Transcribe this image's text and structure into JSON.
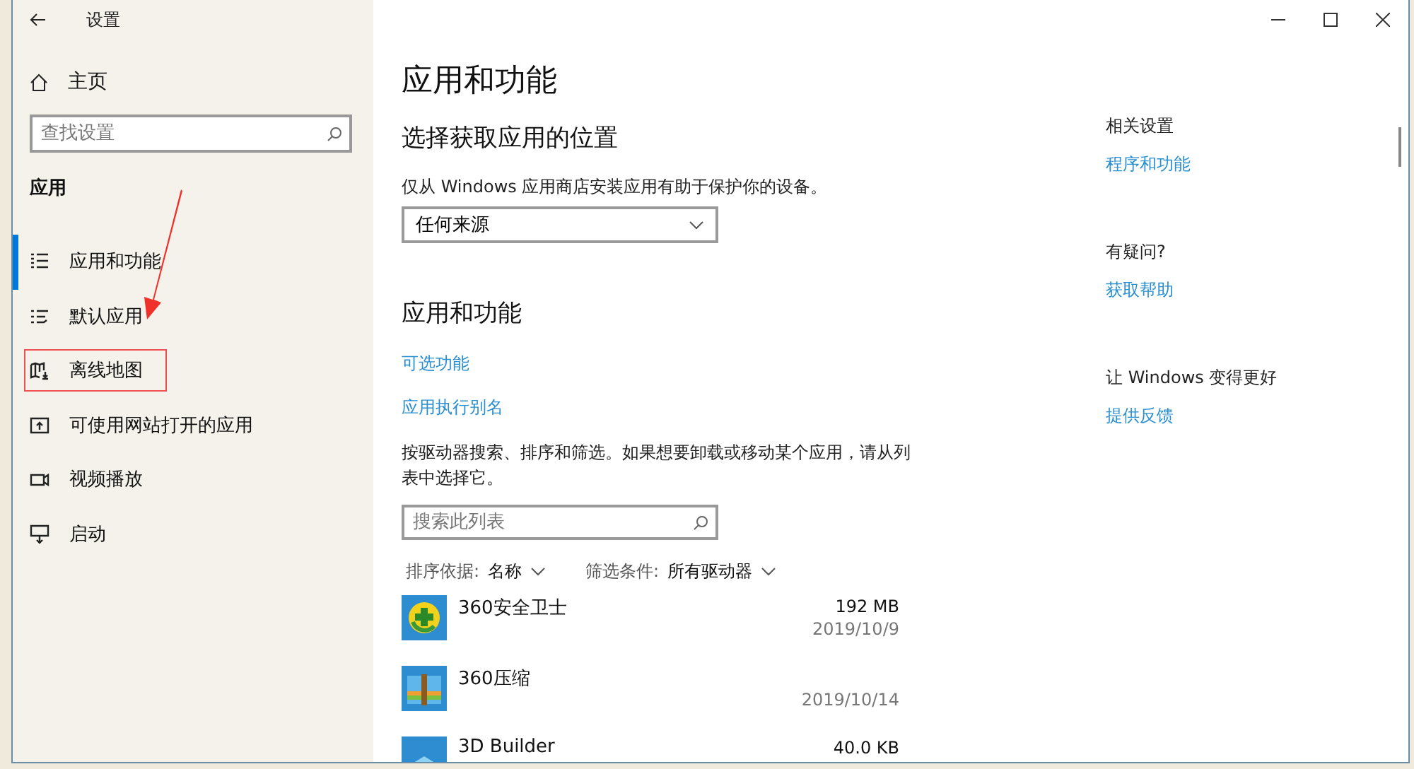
{
  "window": {
    "title": "设置"
  },
  "sidebar": {
    "home": "主页",
    "search": {
      "placeholder": "查找设置"
    },
    "section": "应用",
    "items": [
      {
        "label": "应用和功能",
        "kind": "list",
        "selected": true
      },
      {
        "label": "默认应用",
        "kind": "defaults",
        "selected": false
      },
      {
        "label": "离线地图",
        "kind": "map",
        "selected": false,
        "highlighted": true
      },
      {
        "label": "可使用网站打开的应用",
        "kind": "web",
        "selected": false
      },
      {
        "label": "视频播放",
        "kind": "video",
        "selected": false
      },
      {
        "label": "启动",
        "kind": "startup",
        "selected": false
      }
    ]
  },
  "main": {
    "title": "应用和功能",
    "source": {
      "heading": "选择获取应用的位置",
      "description": "仅从 Windows 应用商店安装应用有助于保护你的设备。",
      "select": "任何来源"
    },
    "apps_section": {
      "heading": "应用和功能",
      "links": [
        "可选功能",
        "应用执行别名"
      ],
      "description": "按驱动器搜索、排序和筛选。如果想要卸载或移动某个应用，请从列表中选择它。",
      "search": {
        "placeholder": "搜索此列表"
      },
      "sort": {
        "label": "排序依据:",
        "value": "名称"
      },
      "filter": {
        "label": "筛选条件:",
        "value": "所有驱动器"
      },
      "apps": [
        {
          "name": "360安全卫士",
          "size": "192 MB",
          "date": "2019/10/9",
          "kind": "shield"
        },
        {
          "name": "360压缩",
          "date": "2019/10/14",
          "kind": "archive"
        },
        {
          "name": "3D Builder",
          "size": "40.0 KB",
          "kind": "builder"
        }
      ]
    }
  },
  "related": [
    {
      "heading": "相关设置",
      "link": "程序和功能"
    },
    {
      "heading": "有疑问?",
      "link": "获取帮助"
    },
    {
      "heading": "让 Windows 变得更好",
      "link": "提供反馈"
    }
  ],
  "annotation_arrow": true
}
